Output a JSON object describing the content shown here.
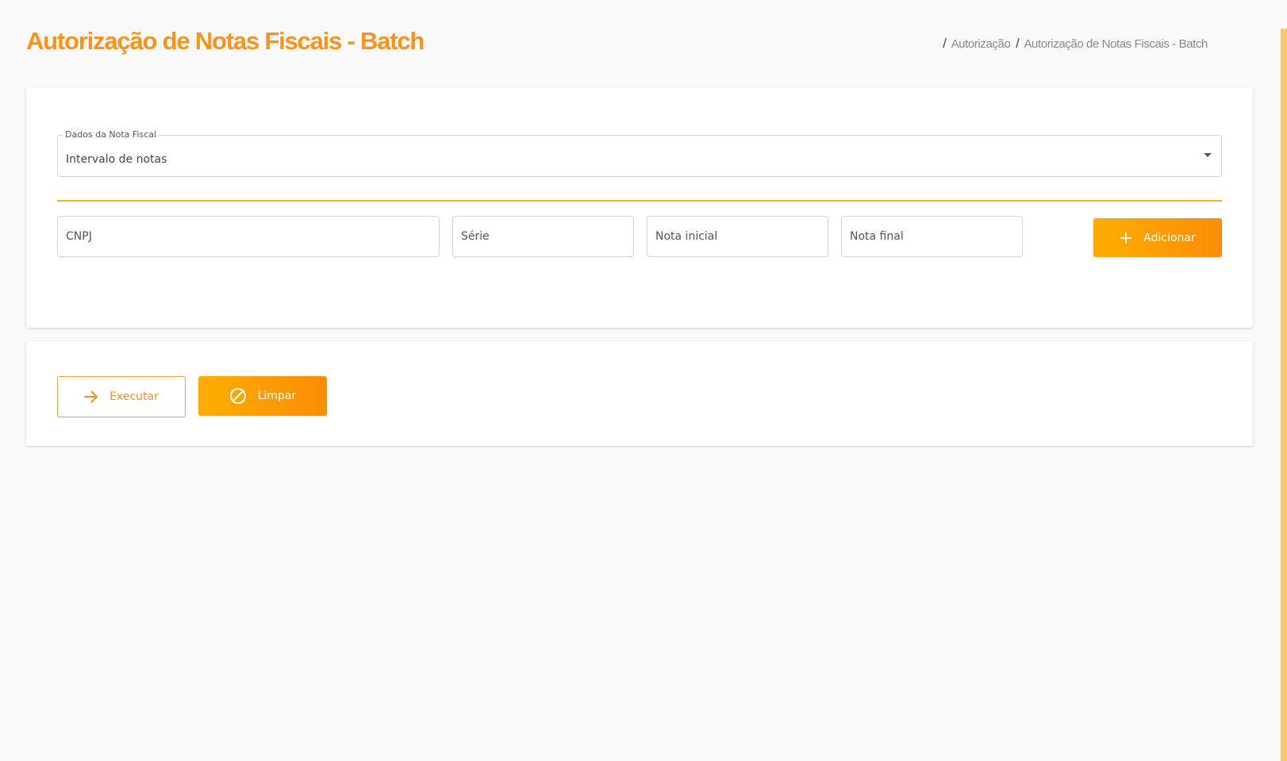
{
  "header": {
    "title": "Autorização de Notas Fiscais - Batch",
    "breadcrumb": {
      "separator": "/",
      "items": [
        "Autorização",
        "Autorização de Notas Fiscais - Batch"
      ]
    }
  },
  "form": {
    "select": {
      "legend": "Dados da Nota Fiscal",
      "value": "Intervalo de notas"
    },
    "inputs": {
      "cnpj_placeholder": "CNPJ",
      "serie_placeholder": "Série",
      "nota_inicial_placeholder": "Nota inicial",
      "nota_final_placeholder": "Nota final"
    },
    "add_button": {
      "label": "Adicionar",
      "icon": "plus-icon"
    }
  },
  "actions": {
    "execute_button": {
      "label": "Executar",
      "icon": "arrow-right-icon"
    },
    "clear_button": {
      "label": "Limpar",
      "icon": "block-icon"
    }
  },
  "colors": {
    "accent": "#f7931e",
    "gradient_start": "#ffae00",
    "gradient_end": "#fb8c07",
    "divider": "#f0b41e",
    "background": "#f9f9f9"
  }
}
